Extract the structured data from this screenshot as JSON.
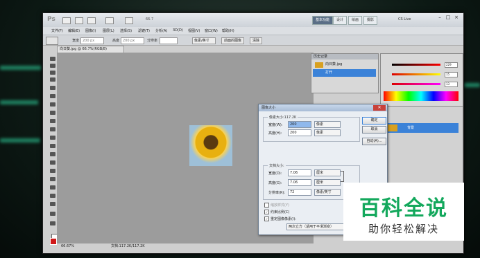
{
  "app": {
    "logo_text": "Ps",
    "zoom_value": "66.7",
    "workspace_buttons": [
      "基本功能",
      "设计",
      "绘画",
      "摄影"
    ],
    "cs_live": "CS Live"
  },
  "menu": [
    "文件(F)",
    "编辑(E)",
    "图像(I)",
    "图层(L)",
    "选择(S)",
    "滤镜(T)",
    "分析(A)",
    "3D(D)",
    "视图(V)",
    "窗口(W)",
    "帮助(H)"
  ],
  "options_bar": {
    "width_label": "宽度",
    "width_value": "200 px",
    "height_label": "高度",
    "height_value": "200 px",
    "resolution_label": "分辨率",
    "unit_select": "像素/英寸",
    "front_image_btn": "前面的图像",
    "clear_btn": "清除"
  },
  "document": {
    "tab_title": "向日葵.jpg @ 66.7%(RGB/8)",
    "status_zoom": "66.67%",
    "status_doc": "文档:117.2K/117.2K"
  },
  "history_panel": {
    "title": "历史记录",
    "rows": [
      "向日葵.jpg",
      "打开"
    ]
  },
  "color_panel": {
    "r": "229",
    "g": "15",
    "b": "13"
  },
  "layers_panel": {
    "layer_name": "背景"
  },
  "dialog": {
    "title": "图像大小",
    "pixel_dimensions": "像素大小:117.2K",
    "width_label": "宽度(W):",
    "width_value": "200",
    "width_unit": "像素",
    "height_label": "高度(H):",
    "height_value": "200",
    "height_unit": "像素",
    "doc_size": "文档大小:",
    "doc_width_label": "宽度(D):",
    "doc_width_value": "7.06",
    "doc_width_unit": "厘米",
    "doc_height_label": "高度(G):",
    "doc_height_value": "7.06",
    "doc_height_unit": "厘米",
    "resolution_label": "分辨率(R):",
    "resolution_value": "72",
    "resolution_unit": "像素/英寸",
    "scale_styles": "缩放样式(Y)",
    "constrain": "约束比例(C)",
    "resample": "重定图像像素(I):",
    "resample_method": "两次立方（适用于平滑渐变）",
    "ok_btn": "确定",
    "cancel_btn": "取消",
    "auto_btn": "自动(A)..."
  },
  "watermark": {
    "big": "百科全说",
    "small": "助你轻松解决"
  }
}
